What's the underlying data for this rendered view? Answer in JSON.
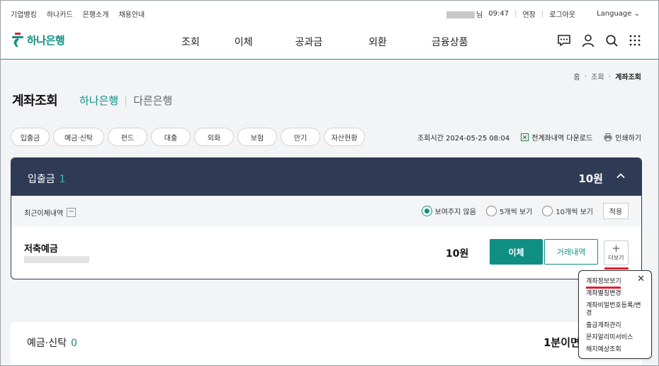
{
  "util": {
    "links": [
      "기업뱅킹",
      "하나카드",
      "은행소개",
      "채용안내"
    ],
    "user_suffix": "님",
    "timer": "09:47",
    "extend": "연장",
    "logout": "로그아웃",
    "language": "Language"
  },
  "logo": {
    "text": "하나은행"
  },
  "gnb": {
    "menu": [
      "조회",
      "이체",
      "공과금",
      "외환",
      "금융상품"
    ]
  },
  "breadcrumb": [
    "홈",
    "조회",
    "계좌조회"
  ],
  "page": {
    "title": "계좌조회",
    "tab_hana": "하나은행",
    "tab_other": "다른은행"
  },
  "chips": [
    "입출금",
    "예금·신탁",
    "펀드",
    "대출",
    "외화",
    "보험",
    "만기",
    "자산현황"
  ],
  "meta": {
    "query_time": "조회시간 2024-05-25 08:04",
    "download": "전계좌내역 다운로드",
    "print": "인쇄하기"
  },
  "section_deposit": {
    "label": "입출금",
    "count": "1",
    "total": "10원",
    "recent_transfer": "최근이체내역",
    "radio_options": [
      "보여주지 않음",
      "5개씩 보기",
      "10개씩 보기"
    ],
    "selected_option": "보여주지 않음",
    "apply": "적용",
    "account": {
      "name": "저축예금",
      "balance": "10원",
      "transfer_btn": "이체",
      "history_btn": "거래내역",
      "more_btn": "더보기"
    }
  },
  "section_savings": {
    "label": "예금·신탁",
    "count": "0",
    "total_partial": "1분이면"
  },
  "more_menu": {
    "items": [
      "계좌정보보기",
      "계좌별칭변경",
      "계좌비밀번호등록/변경",
      "출금계좌관리",
      "문자알리미서비스",
      "해지예상조회"
    ]
  },
  "colors": {
    "accent": "#0f8f84",
    "header_dark": "#2f3a55",
    "highlight_red": "#e11d2e"
  }
}
